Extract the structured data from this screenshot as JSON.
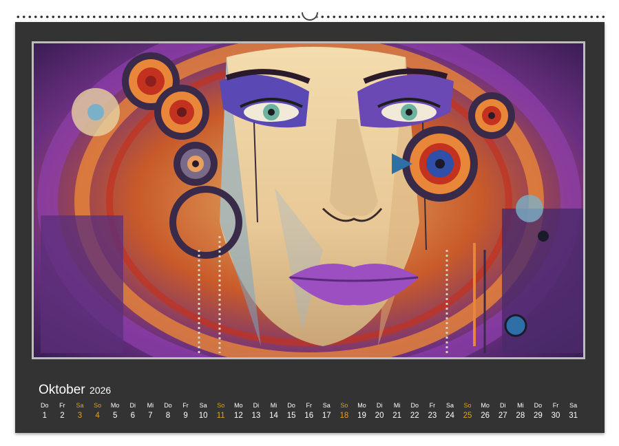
{
  "calendar": {
    "month": "Oktober",
    "year": "2026",
    "accent_color": "#e0a41c",
    "days": [
      {
        "dow": "Do",
        "num": "1",
        "weekend": false
      },
      {
        "dow": "Fr",
        "num": "2",
        "weekend": false
      },
      {
        "dow": "Sa",
        "num": "3",
        "weekend": true
      },
      {
        "dow": "So",
        "num": "4",
        "weekend": true
      },
      {
        "dow": "Mo",
        "num": "5",
        "weekend": false
      },
      {
        "dow": "Di",
        "num": "6",
        "weekend": false
      },
      {
        "dow": "Mi",
        "num": "7",
        "weekend": false
      },
      {
        "dow": "Do",
        "num": "8",
        "weekend": false
      },
      {
        "dow": "Fr",
        "num": "9",
        "weekend": false
      },
      {
        "dow": "Sa",
        "num": "10",
        "weekend": false
      },
      {
        "dow": "So",
        "num": "11",
        "weekend": true
      },
      {
        "dow": "Mo",
        "num": "12",
        "weekend": false
      },
      {
        "dow": "Di",
        "num": "13",
        "weekend": false
      },
      {
        "dow": "Mi",
        "num": "14",
        "weekend": false
      },
      {
        "dow": "Do",
        "num": "15",
        "weekend": false
      },
      {
        "dow": "Fr",
        "num": "16",
        "weekend": false
      },
      {
        "dow": "Sa",
        "num": "17",
        "weekend": false
      },
      {
        "dow": "So",
        "num": "18",
        "weekend": true
      },
      {
        "dow": "Mo",
        "num": "19",
        "weekend": false
      },
      {
        "dow": "Di",
        "num": "20",
        "weekend": false
      },
      {
        "dow": "Mi",
        "num": "21",
        "weekend": false
      },
      {
        "dow": "Do",
        "num": "22",
        "weekend": false
      },
      {
        "dow": "Fr",
        "num": "23",
        "weekend": false
      },
      {
        "dow": "Sa",
        "num": "24",
        "weekend": false
      },
      {
        "dow": "So",
        "num": "25",
        "weekend": true
      },
      {
        "dow": "Mo",
        "num": "26",
        "weekend": false
      },
      {
        "dow": "Di",
        "num": "27",
        "weekend": false
      },
      {
        "dow": "Mi",
        "num": "28",
        "weekend": false
      },
      {
        "dow": "Do",
        "num": "29",
        "weekend": false
      },
      {
        "dow": "Fr",
        "num": "30",
        "weekend": false
      },
      {
        "dow": "Sa",
        "num": "31",
        "weekend": false
      }
    ]
  },
  "artwork": {
    "palette": [
      "#5b2f7a",
      "#e8863a",
      "#2f6fa8",
      "#f2d9a8",
      "#8e3fae",
      "#c2321f"
    ]
  }
}
